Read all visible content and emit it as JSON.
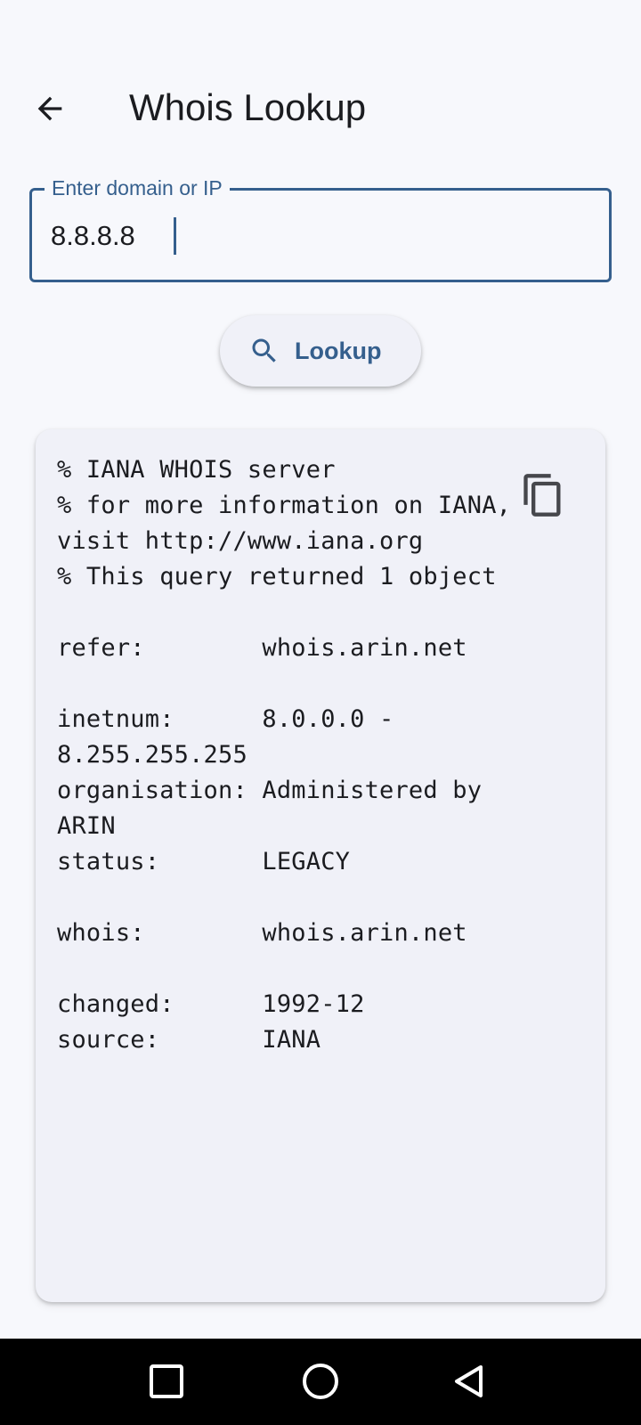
{
  "header": {
    "title": "Whois Lookup",
    "back_icon": "arrow-back-icon"
  },
  "search": {
    "label": "Enter domain or IP",
    "value": "8.8.8.8"
  },
  "lookup_button": {
    "label": "Lookup",
    "icon": "search-icon"
  },
  "result": {
    "lines": [
      "% IANA WHOIS server",
      "% for more information on IANA,",
      "visit http://www.iana.org",
      "% This query returned 1 object",
      "",
      "refer:        whois.arin.net",
      "",
      "inetnum:      8.0.0.0 -",
      "8.255.255.255",
      "organisation: Administered by",
      "ARIN",
      "status:       LEGACY",
      "",
      "whois:        whois.arin.net",
      "",
      "changed:      1992-12",
      "source:       IANA"
    ],
    "copy_icon": "copy-icon"
  },
  "system_nav": {
    "recents_icon": "square-recents-icon",
    "home_icon": "circle-home-icon",
    "back_icon": "triangle-back-icon"
  },
  "colors": {
    "background": "#f7f8fc",
    "accent": "#355f8d",
    "surface": "#f0f1f8",
    "text": "#1b1c20",
    "nav_bar": "#000000"
  }
}
